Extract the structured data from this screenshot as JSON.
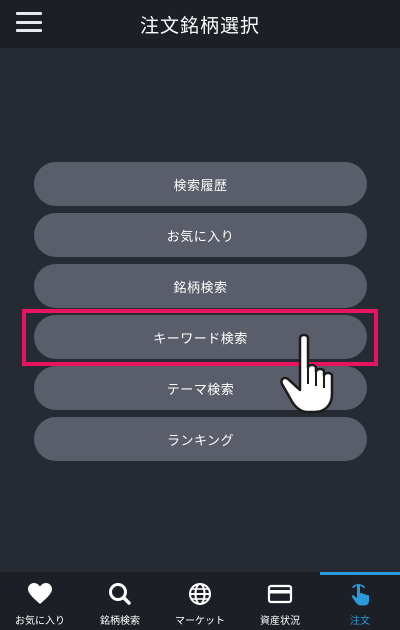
{
  "header": {
    "title": "注文銘柄選択",
    "menu_icon": "hamburger-icon"
  },
  "menu": {
    "items": [
      {
        "label": "検索履歴"
      },
      {
        "label": "お気に入り"
      },
      {
        "label": "銘柄検索"
      },
      {
        "label": "キーワード検索"
      },
      {
        "label": "テーマ検索"
      },
      {
        "label": "ランキング"
      }
    ],
    "highlighted_index": 3,
    "highlight_color": "#e8145f"
  },
  "tabbar": {
    "items": [
      {
        "label": "お気に入り",
        "icon": "heart-icon"
      },
      {
        "label": "銘柄検索",
        "icon": "search-icon"
      },
      {
        "label": "マーケット",
        "icon": "globe-icon"
      },
      {
        "label": "資産状況",
        "icon": "card-icon"
      },
      {
        "label": "注文",
        "icon": "tap-hand-icon"
      }
    ],
    "active_index": 4,
    "accent_color": "#2a9ad8"
  }
}
